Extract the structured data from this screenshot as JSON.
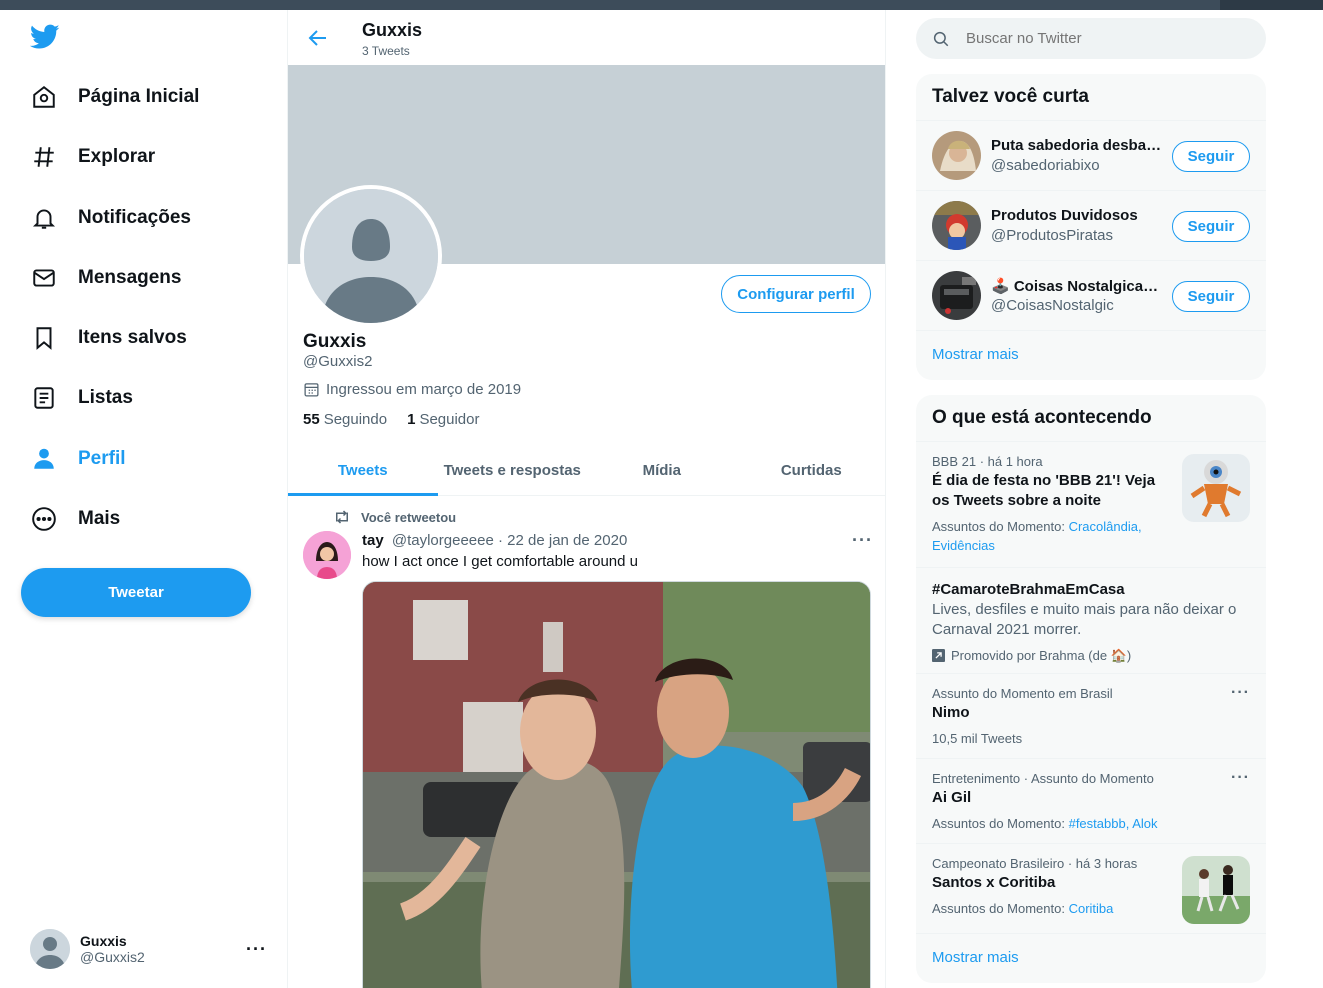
{
  "nav": {
    "items": [
      {
        "label": "Página Inicial",
        "icon": "home-icon"
      },
      {
        "label": "Explorar",
        "icon": "hashtag-icon"
      },
      {
        "label": "Notificações",
        "icon": "bell-icon"
      },
      {
        "label": "Mensagens",
        "icon": "envelope-icon"
      },
      {
        "label": "Itens salvos",
        "icon": "bookmark-icon"
      },
      {
        "label": "Listas",
        "icon": "list-icon"
      },
      {
        "label": "Perfil",
        "icon": "person-icon",
        "active": true
      },
      {
        "label": "Mais",
        "icon": "more-circle-icon"
      }
    ],
    "tweet_button": "Tweetar",
    "account": {
      "name": "Guxxis",
      "handle": "@Guxxis2"
    }
  },
  "header": {
    "title": "Guxxis",
    "subtitle": "3 Tweets"
  },
  "profile": {
    "edit_button": "Configurar perfil",
    "name": "Guxxis",
    "handle": "@Guxxis2",
    "joined": "Ingressou em março de 2019",
    "following_count": "55",
    "following_label": "Seguindo",
    "followers_count": "1",
    "followers_label": "Seguidor"
  },
  "tabs": [
    "Tweets",
    "Tweets e respostas",
    "Mídia",
    "Curtidas"
  ],
  "tweet": {
    "retweet_label": "Você retweetou",
    "author": "tay",
    "handle": "@taylorgeeeee",
    "date": "22 de jan de 2020",
    "text": "how I act once I get comfortable around u"
  },
  "search": {
    "placeholder": "Buscar no Twitter"
  },
  "who_to_follow": {
    "title": "Talvez você curta",
    "users": [
      {
        "name": "Puta sabedoria desbalanceada",
        "handle": "@sabedoriabixo",
        "button": "Seguir"
      },
      {
        "name": "Produtos Duvidosos",
        "handle": "@ProdutosPiratas",
        "button": "Seguir"
      },
      {
        "name": "🕹️ Coisas Nostalgicas 📼",
        "handle": "@CoisasNostalgic",
        "button": "Seguir"
      }
    ],
    "show_more": "Mostrar mais"
  },
  "trends": {
    "title": "O que está acontecendo",
    "items": [
      {
        "meta": "BBB 21 · há 1 hora",
        "title": "É dia de festa no 'BBB 21'! Veja os Tweets sobre a noite",
        "sub_label": "Assuntos do Momento:",
        "sub_links": "Cracolândia, Evidências"
      },
      {
        "title": "#CamaroteBrahmaEmCasa",
        "desc": "Lives, desfiles e muito mais para não deixar o Carnaval 2021 morrer.",
        "promo": "Promovido por Brahma (de 🏠)"
      },
      {
        "meta": "Assunto do Momento em Brasil",
        "title": "Nimo",
        "count": "10,5 mil Tweets"
      },
      {
        "meta": "Entretenimento · Assunto do Momento",
        "title": "Ai Gil",
        "sub_label": "Assuntos do Momento:",
        "sub_links": "#festabbb, Alok"
      },
      {
        "meta": "Campeonato Brasileiro · há 3 horas",
        "title": "Santos x Coritiba",
        "sub_label": "Assuntos do Momento:",
        "sub_links": "Coritiba"
      }
    ],
    "show_more": "Mostrar mais"
  },
  "colors": {
    "accent": "#1d9bf0",
    "text": "#0f1419",
    "muted": "#536471",
    "banner": "#c6d0d6"
  }
}
